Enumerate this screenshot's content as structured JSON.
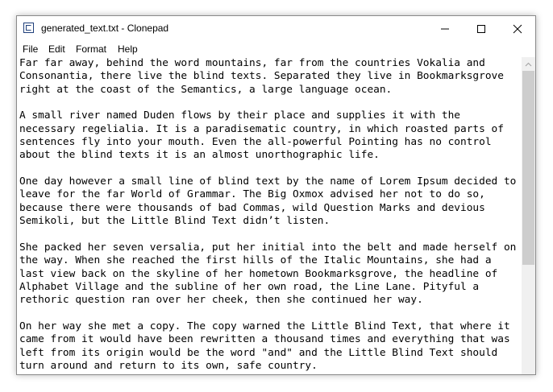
{
  "window": {
    "title": "generated_text.txt - Clonepad"
  },
  "menu": {
    "file": "File",
    "edit": "Edit",
    "format": "Format",
    "help": "Help"
  },
  "icons": {
    "app": "clonepad-app-icon",
    "minimize": "minimize-icon",
    "maximize": "maximize-icon",
    "close": "close-icon",
    "scroll_up": "chevron-up-icon"
  },
  "editor": {
    "text": "Far far away, behind the word mountains, far from the countries Vokalia and\nConsonantia, there live the blind texts. Separated they live in Bookmarksgrove\nright at the coast of the Semantics, a large language ocean.\n\nA small river named Duden flows by their place and supplies it with the\nnecessary regelialia. It is a paradisematic country, in which roasted parts of\nsentences fly into your mouth. Even the all-powerful Pointing has no control\nabout the blind texts it is an almost unorthographic life.\n\nOne day however a small line of blind text by the name of Lorem Ipsum decided to\nleave for the far World of Grammar. The Big Oxmox advised her not to do so,\nbecause there were thousands of bad Commas, wild Question Marks and devious\nSemikoli, but the Little Blind Text didn’t listen.\n\nShe packed her seven versalia, put her initial into the belt and made herself on\nthe way. When she reached the first hills of the Italic Mountains, she had a\nlast view back on the skyline of her hometown Bookmarksgrove, the headline of\nAlphabet Village and the subline of her own road, the Line Lane. Pityful a\nrethoric question ran over her cheek, then she continued her way.\n\nOn her way she met a copy. The copy warned the Little Blind Text, that where it\ncame from it would have been rewritten a thousand times and everything that was\nleft from its origin would be the word \"and\" and the Little Blind Text should\nturn around and return to its own, safe country."
  },
  "colors": {
    "window_border": "#8a8a8a",
    "scrollbar_track": "#f0f0f0",
    "scrollbar_thumb": "#cdcdcd",
    "icon_blue": "#1f3f7a"
  }
}
